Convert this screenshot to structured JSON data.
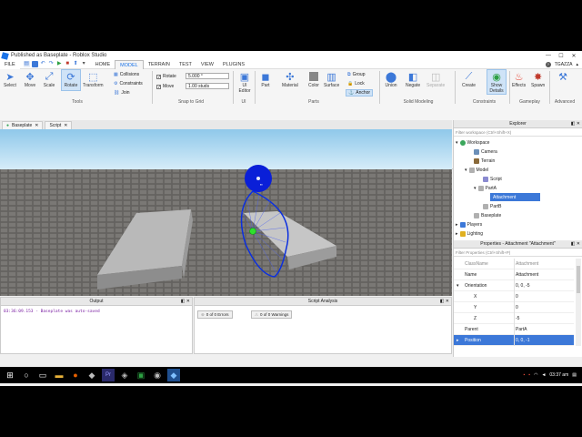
{
  "window": {
    "title": "Published as Baseplate - Roblox Studio",
    "controls": [
      "—",
      "☐",
      "✕"
    ]
  },
  "menu": {
    "file": "FILE",
    "tabs": [
      "HOME",
      "MODEL",
      "TERRAIN",
      "TEST",
      "VIEW",
      "PLUGINS"
    ],
    "active_tab": "MODEL",
    "user": "TGAZZA"
  },
  "ribbon": {
    "tools": {
      "label": "Tools",
      "select": "Select",
      "move": "Move",
      "scale": "Scale",
      "rotate": "Rotate",
      "transform": "Transform",
      "collisions": "Collisions",
      "constraints": "Constraints",
      "join": "Join"
    },
    "snap": {
      "label": "Snap to Grid",
      "rotate_label": "Rotate",
      "rotate_value": "5.000 °",
      "move_label": "Move",
      "move_value": "1.00 studs"
    },
    "ui": {
      "label": "UI",
      "ui_editor": "UI Editor"
    },
    "parts": {
      "label": "Parts",
      "part": "Part",
      "material": "Material",
      "color": "Color",
      "surface": "Surface",
      "group": "Group",
      "lock": "Lock",
      "anchor": "Anchor"
    },
    "solid": {
      "label": "Solid Modeling",
      "union": "Union",
      "negate": "Negate",
      "separate": "Separate"
    },
    "constraints": {
      "label": "Constraints",
      "create": "Create",
      "show_details": "Show Details"
    },
    "gameplay": {
      "label": "Gameplay",
      "effects": "Effects",
      "spawn": "Spawn"
    },
    "advanced": {
      "label": "Advanced"
    }
  },
  "doc_tabs": [
    {
      "label": "Baseplate"
    },
    {
      "label": "Script"
    }
  ],
  "explorer": {
    "title": "Explorer",
    "filter_placeholder": "Filter workspace (Ctrl+Shift+X)",
    "items": [
      {
        "label": "Workspace",
        "color": "#3aa65b"
      },
      {
        "label": "Camera",
        "color": "#6b8fb8"
      },
      {
        "label": "Terrain",
        "color": "#8a6a3a"
      },
      {
        "label": "Model",
        "color": "#b0b0b0"
      },
      {
        "label": "Script",
        "color": "#8a8ad0"
      },
      {
        "label": "PartA",
        "color": "#b0b0b0"
      },
      {
        "label": "Attachment",
        "color": "#3aa65b"
      },
      {
        "label": "PartB",
        "color": "#b0b0b0"
      },
      {
        "label": "Baseplate",
        "color": "#b0b0b0"
      },
      {
        "label": "Players",
        "color": "#3c78d8"
      },
      {
        "label": "Lighting",
        "color": "#e0b020"
      }
    ]
  },
  "properties": {
    "title": "Properties - Attachment \"Attachment\"",
    "filter_placeholder": "Filter Properties (Ctrl+Shift+P)",
    "rows": [
      {
        "name": "ClassName",
        "value": "Attachment"
      },
      {
        "name": "Name",
        "value": "Attachment"
      },
      {
        "name": "Orientation",
        "value": "0, 0, -5"
      },
      {
        "name": "X",
        "value": "0"
      },
      {
        "name": "Y",
        "value": "0"
      },
      {
        "name": "Z",
        "value": "-5"
      },
      {
        "name": "Parent",
        "value": "PartA"
      },
      {
        "name": "Position",
        "value": "0, 0, -1"
      }
    ]
  },
  "output": {
    "title": "Output",
    "lines": [
      {
        "time": "03:36:09.153",
        "text": " - Baseplate was auto-saved"
      }
    ]
  },
  "analysis": {
    "title": "Script Analysis",
    "errors": "0 of 0 Errors",
    "warnings": "0 of 0 Warnings"
  },
  "taskbar": {
    "time": "03:37 am"
  }
}
